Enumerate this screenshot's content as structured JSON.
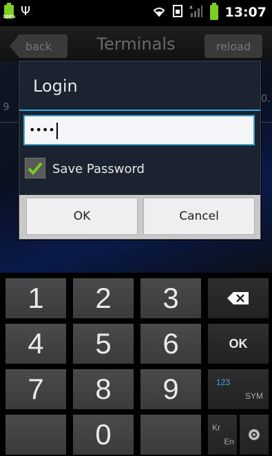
{
  "status_bar": {
    "battery_small_label": "100%",
    "time": "13:07"
  },
  "app_bar": {
    "back_label": "back",
    "title": "Terminals",
    "reload_label": "reload"
  },
  "background": {
    "left_text": "9",
    "right_text": "0."
  },
  "dialog": {
    "title": "Login",
    "password_value": "••••",
    "save_password_label": "Save Password",
    "save_password_checked": true,
    "ok_label": "OK",
    "cancel_label": "Cancel"
  },
  "keypad": {
    "keys": [
      "1",
      "2",
      "3",
      "4",
      "5",
      "6",
      "7",
      "8",
      "9",
      "0"
    ],
    "ok_label": "OK",
    "sym_top": "123",
    "sym_bottom": "SYM",
    "lang_top": "Kr",
    "lang_bottom": "En"
  },
  "colors": {
    "accent": "#39a9d6",
    "check_green": "#7ccf22"
  }
}
